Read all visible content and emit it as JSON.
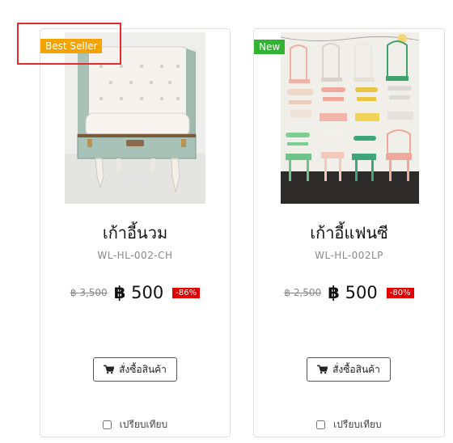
{
  "products": [
    {
      "badge": "Best Seller",
      "name": "เก้าอี้นวม",
      "sku": "WL-HL-002-CH",
      "old_price": "฿ 3,500",
      "currency": "฿",
      "price": "500",
      "discount": "-86%",
      "order_label": "สั่งซื้อสินค้า",
      "compare_label": "เปรียบเทียบ"
    },
    {
      "badge": "New",
      "name": "เก้าอี้แฟนซี",
      "sku": "WL-HL-002LP",
      "old_price": "฿ 2,500",
      "currency": "฿",
      "price": "500",
      "discount": "-80%",
      "order_label": "สั่งซื้อสินค้า",
      "compare_label": "เปรียบเทียบ"
    }
  ],
  "colors": {
    "best_seller": "#f5a300",
    "new": "#34b233",
    "discount": "#e00000",
    "highlight": "#e32b2b"
  }
}
